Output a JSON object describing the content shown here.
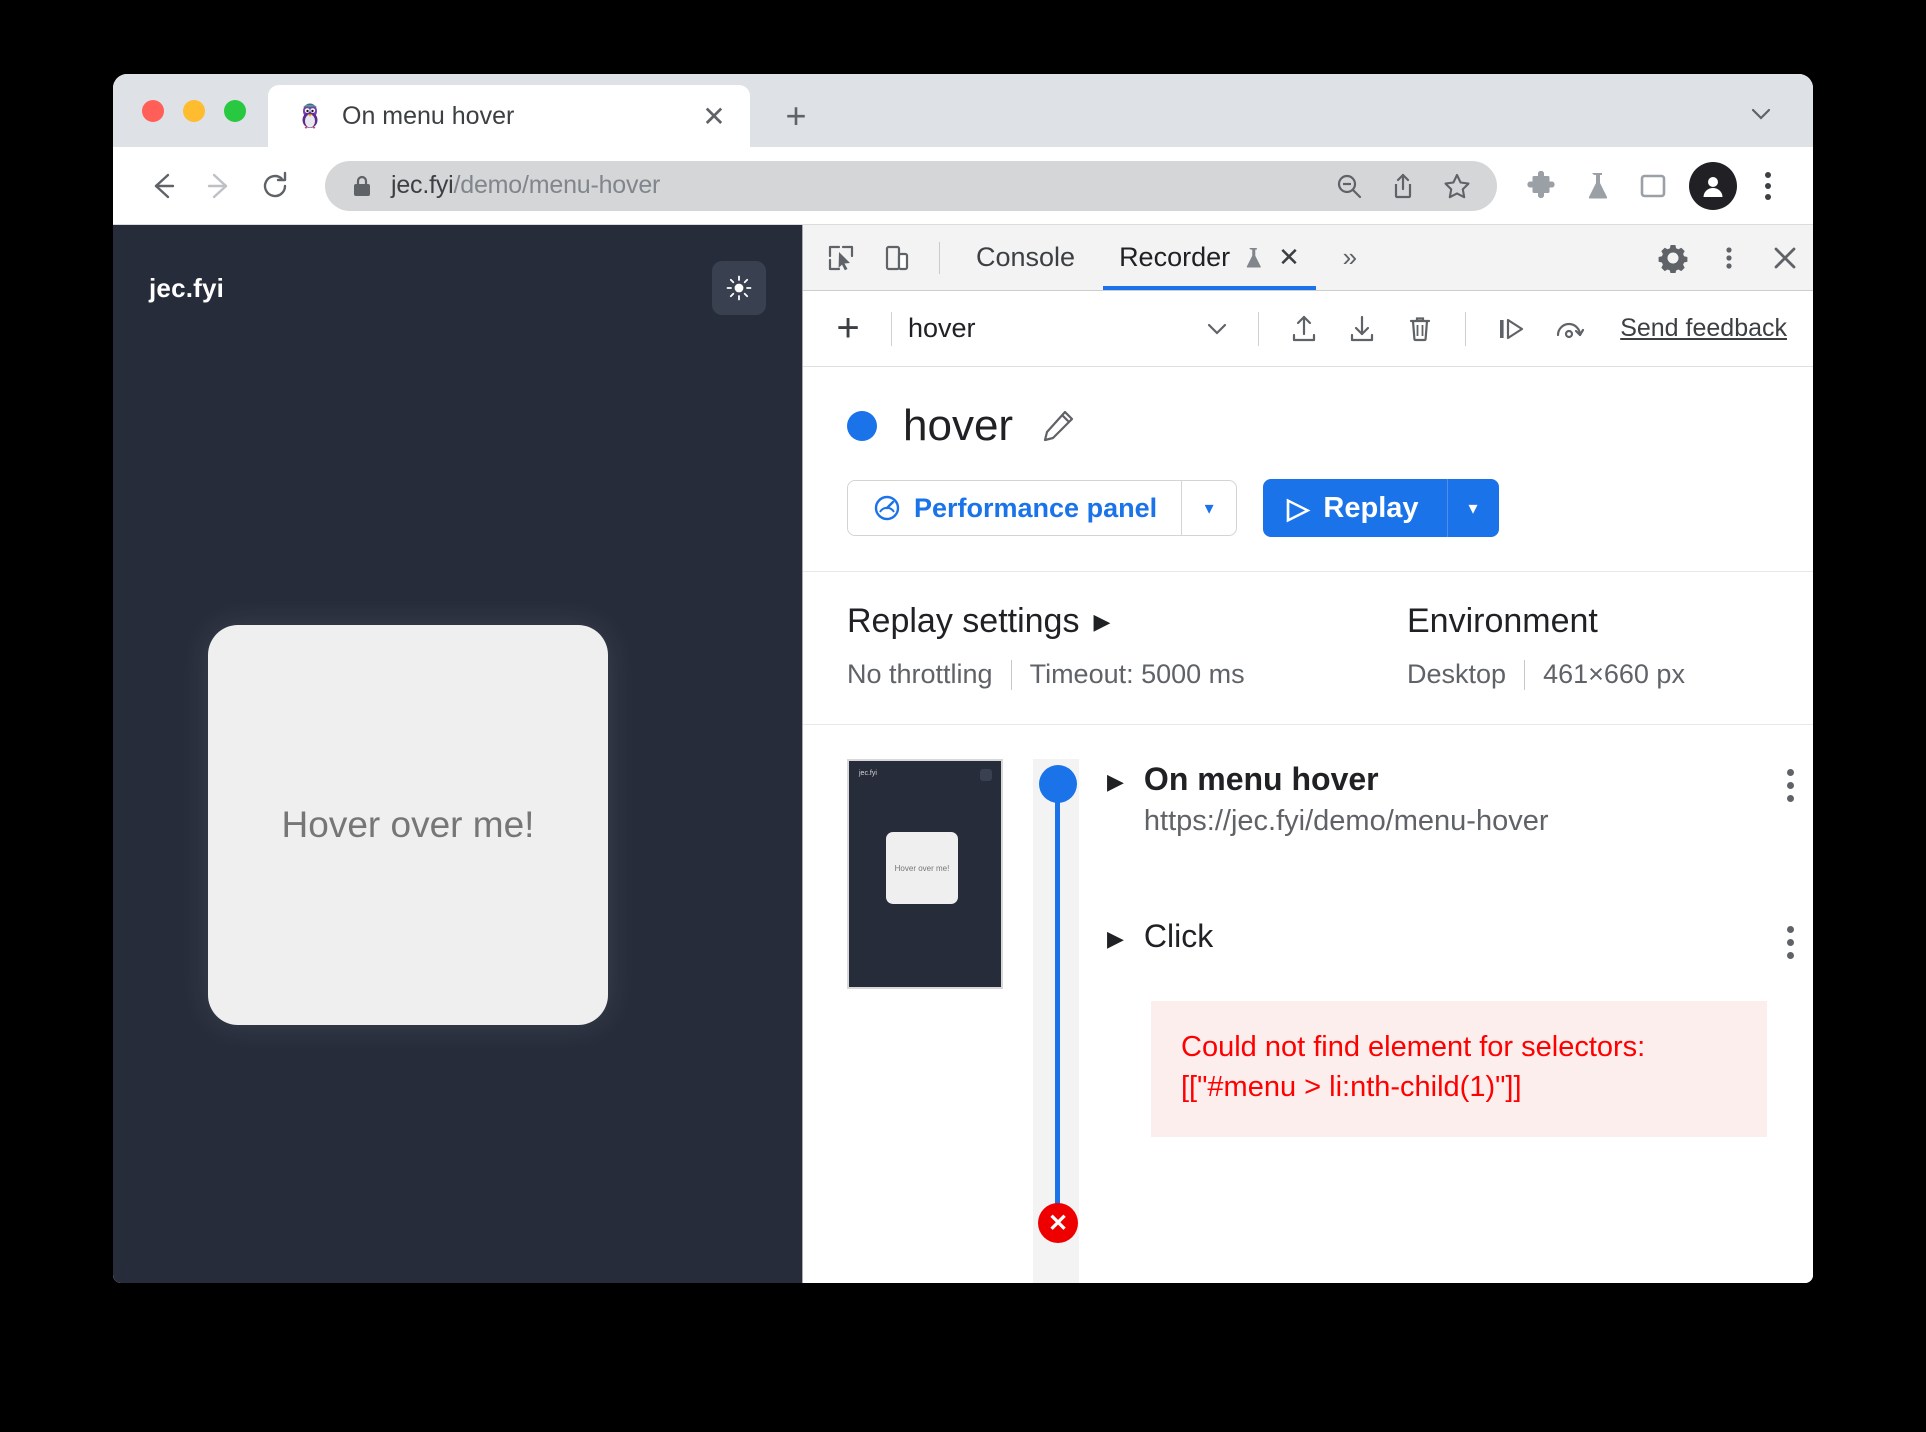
{
  "browser": {
    "tab": {
      "title": "On menu hover",
      "favicon": "penguin-favicon",
      "close_label": "✕"
    },
    "new_tab_label": "+",
    "tabstrip_chevron": "chevron-down-icon",
    "nav": {
      "back": "←",
      "forward": "→",
      "reload": "⟳"
    },
    "omnibox": {
      "url_host": "jec.fyi",
      "url_path": "/demo/menu-hover",
      "lock": "lock-icon",
      "zoom_out": "zoom-out-icon",
      "share": "share-icon",
      "bookmark": "star-icon"
    },
    "toolbar_icons": [
      "puzzle-icon",
      "flask-icon",
      "side-panel-icon",
      "profile-avatar-icon",
      "kebab-menu-icon"
    ]
  },
  "page": {
    "brand": "jec.fyi",
    "theme_toggle": "sun-icon",
    "card_label": "Hover over me!"
  },
  "devtools": {
    "tabbar": {
      "inspect_icon": "inspect-element-icon",
      "device_icon": "device-toolbar-icon",
      "tabs": [
        {
          "label": "Console",
          "active": false,
          "has_experiment": false,
          "closable": false
        },
        {
          "label": "Recorder",
          "active": true,
          "has_experiment": true,
          "closable": true,
          "close_label": "✕"
        }
      ],
      "more_tabs": "»",
      "settings_icon": "gear-icon",
      "menu_icon": "kebab-menu-icon",
      "close_icon": "close-icon"
    },
    "actionbar": {
      "add_label": "+",
      "selected_recording": "hover",
      "chevron": "chevron-down-icon",
      "import_icon": "import-icon",
      "export_icon": "export-icon",
      "delete_icon": "trash-icon",
      "step_by_step_icon": "play-step-icon",
      "slow_replay_icon": "replay-speed-icon",
      "feedback_label": "Send feedback"
    },
    "recording": {
      "name": "hover",
      "status_dot_color": "#1a73e8",
      "edit_icon": "pencil-icon",
      "perf_button_label": "Performance panel",
      "perf_button_icon": "performance-icon",
      "perf_caret": "▾",
      "replay_button_label": "Replay",
      "replay_play_icon": "▷",
      "replay_caret": "▾"
    },
    "replay_settings": {
      "title": "Replay settings",
      "expand_caret": "▶",
      "throttling": "No throttling",
      "timeout": "Timeout: 5000 ms"
    },
    "environment": {
      "title": "Environment",
      "device": "Desktop",
      "viewport": "461×660 px"
    },
    "thumbnail": {
      "brand": "jec.fyi",
      "card_label": "Hover over me!"
    },
    "steps": [
      {
        "caret": "▶",
        "title": "On menu hover",
        "subtitle": "https://jec.fyi/demo/menu-hover",
        "kebab": "kebab-menu-icon",
        "marker": "start"
      },
      {
        "caret": "▶",
        "title": "Click",
        "subtitle": "",
        "kebab": "kebab-menu-icon",
        "marker": "error"
      }
    ],
    "error": {
      "line1": "Could not find element for selectors:",
      "line2": "[[\"#menu > li:nth-child(1)\"]]",
      "color": "#ff0000",
      "background": "#fdeeee"
    }
  }
}
